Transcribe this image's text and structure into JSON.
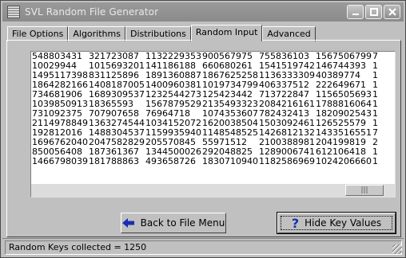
{
  "window": {
    "title": "SVL Random File Generator",
    "icons": {
      "app": "app-icon",
      "minimize": "minimize-icon",
      "maximize": "maximize-icon",
      "close": "close-icon"
    }
  },
  "tabs": [
    {
      "label": "File Options",
      "active": false
    },
    {
      "label": "Algorithms",
      "active": false
    },
    {
      "label": "Distributions",
      "active": false
    },
    {
      "label": "Random Input",
      "active": true
    },
    {
      "label": "Advanced",
      "active": false
    }
  ],
  "keys_rows": [
    [
      "548803431",
      "321723087",
      "1132229353",
      "900567975",
      "755836103",
      "1567506799",
      "7"
    ],
    [
      "10029944",
      "1015693201",
      "141186188",
      "660680261",
      "1541519742",
      "146744393",
      "1"
    ],
    [
      "1495117398",
      "831125896",
      "1891360887",
      "1867625258",
      "1136333309",
      "40389774",
      "1"
    ],
    [
      "1864282166",
      "1408187005",
      "1400960381",
      "1019734799",
      "406337512",
      "222649671",
      "1"
    ],
    [
      "734681906",
      "1689309537",
      "1232544273",
      "125423442",
      "713722847",
      "1156505693",
      "1"
    ],
    [
      "1039850913",
      "18365593",
      "1567879529",
      "2135493323",
      "2084216161",
      "1788816064",
      "1"
    ],
    [
      "731092375",
      "707907658",
      "76964718",
      "1074353607",
      "782432413",
      "1820902543",
      "1"
    ],
    [
      "2114978849",
      "1363274544",
      "1034152072",
      "1620038504",
      "1503092461",
      "126525579",
      "1"
    ],
    [
      "192812016",
      "1488304537",
      "1159935940",
      "1148548525",
      "1426812132",
      "1433516551",
      "7"
    ],
    [
      "1696762040",
      "2047582829",
      "205570845",
      "55971512",
      "2100388981",
      "204199819",
      "2"
    ],
    [
      "850056408",
      "187361367",
      "1344500026",
      "292048825",
      "1289006741",
      "612106418",
      "1"
    ],
    [
      "1466798039",
      "181788863",
      "493658726",
      "1830710940",
      "1182586969",
      "1024206660",
      "1"
    ]
  ],
  "buttons": {
    "back": {
      "label": "Back to File Menu",
      "icon": "arrow-left-icon",
      "icon_color": "#1a2fb0"
    },
    "hide": {
      "label": "Hide Key Values",
      "icon": "question-icon",
      "icon_color": "#1a2fb0"
    }
  },
  "status": {
    "text": "Random Keys collected = 1250"
  },
  "scrollbar": {
    "thumb_glyph": "|||"
  }
}
